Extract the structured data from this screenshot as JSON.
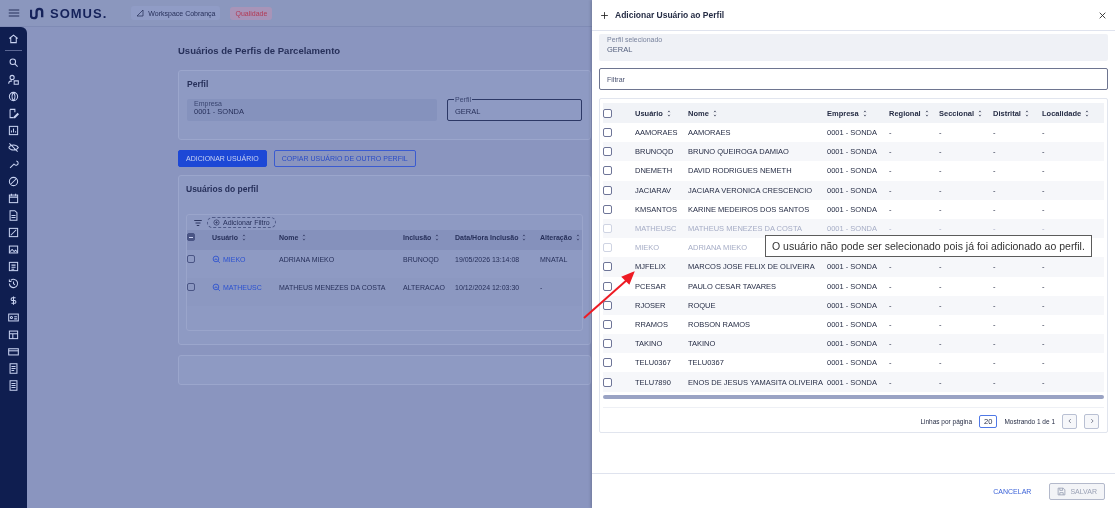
{
  "header": {
    "logo": "SOMUS.",
    "workspace": "Workspace Cobrança",
    "environment": "Qualidade"
  },
  "page": {
    "title": "Usuários de Perfis de Parcelamento",
    "perfil_card": {
      "title": "Perfil",
      "fields": [
        {
          "label": "Empresa",
          "value": "0001 - SONDA",
          "kind": "readonly"
        },
        {
          "label": "Perfil",
          "value": "GERAL",
          "kind": "outlined"
        }
      ]
    },
    "buttons": [
      {
        "label": "ADICIONAR USUÁRIO",
        "kind": "primary"
      },
      {
        "label": "COPIAR USUÁRIO DE OUTRO PERFIL",
        "kind": "outline"
      }
    ],
    "users_card": {
      "title": "Usuários do perfil",
      "filter_chip": "Adicionar Filtro",
      "select_all_indeterminate": true,
      "columns": [
        "Usuário",
        "Nome",
        "Inclusão",
        "Data/Hora Inclusão",
        "Alteração"
      ],
      "rows": [
        {
          "usuario": "MIEKO",
          "nome": "ADRIANA MIEKO",
          "inclusao": "BRUNOQD",
          "data_hora_inclusao": "19/05/2026 13:14:08",
          "alteracao": "MNATAL",
          "checked": false
        },
        {
          "usuario": "MATHEUSC",
          "nome": "MATHEUS MENEZES DA COSTA",
          "inclusao": "ALTERACAO",
          "data_hora_inclusao": "10/12/2024 12:03:30",
          "alteracao": "-",
          "checked": false
        }
      ]
    }
  },
  "drawer": {
    "title": "Adicionar Usuário ao Perfil",
    "selected_profile": {
      "label": "Perfil selecionado",
      "value": "GERAL"
    },
    "filter": {
      "placeholder": "Filtrar"
    },
    "table": {
      "select_all_checked": false,
      "columns": [
        "Usuário",
        "Nome",
        "Empresa",
        "Regional",
        "Seccional",
        "Distrital",
        "Localidade"
      ],
      "rows": [
        {
          "usuario": "AAMORAES",
          "nome": "AAMORAES",
          "empresa": "0001 - SONDA",
          "regional": "-",
          "seccional": "-",
          "distrital": "-",
          "localidade": "-",
          "disabled": false,
          "checked": false
        },
        {
          "usuario": "BRUNOQD",
          "nome": "BRUNO QUEIROGA DAMIAO",
          "empresa": "0001 - SONDA",
          "regional": "-",
          "seccional": "-",
          "distrital": "-",
          "localidade": "-",
          "disabled": false,
          "checked": false
        },
        {
          "usuario": "DNEMETH",
          "nome": "DAVID RODRIGUES NEMETH",
          "empresa": "0001 - SONDA",
          "regional": "-",
          "seccional": "-",
          "distrital": "-",
          "localidade": "-",
          "disabled": false,
          "checked": false
        },
        {
          "usuario": "JACIARAV",
          "nome": "JACIARA VERONICA CRESCENCIO",
          "empresa": "0001 - SONDA",
          "regional": "-",
          "seccional": "-",
          "distrital": "-",
          "localidade": "-",
          "disabled": false,
          "checked": false
        },
        {
          "usuario": "KMSANTOS",
          "nome": "KARINE MEDEIROS DOS SANTOS",
          "empresa": "0001 - SONDA",
          "regional": "-",
          "seccional": "-",
          "distrital": "-",
          "localidade": "-",
          "disabled": false,
          "checked": false
        },
        {
          "usuario": "MATHEUSC",
          "nome": "MATHEUS MENEZES DA COSTA",
          "empresa": "0001 - SONDA",
          "regional": "-",
          "seccional": "-",
          "distrital": "-",
          "localidade": "-",
          "disabled": true,
          "checked": false
        },
        {
          "usuario": "MIEKO",
          "nome": "ADRIANA MIEKO",
          "disabled": true,
          "checked": false,
          "tooltip": "O usuário não pode ser selecionado pois já foi adicionado ao perfil."
        },
        {
          "usuario": "MJFELIX",
          "nome": "MARCOS JOSE FELIX DE OLIVEIRA",
          "empresa": "0001 - SONDA",
          "regional": "-",
          "seccional": "-",
          "distrital": "-",
          "localidade": "-",
          "disabled": false,
          "checked": false
        },
        {
          "usuario": "PCESAR",
          "nome": "PAULO CESAR TAVARES",
          "empresa": "0001 - SONDA",
          "regional": "-",
          "seccional": "-",
          "distrital": "-",
          "localidade": "-",
          "disabled": false,
          "checked": false
        },
        {
          "usuario": "RJOSER",
          "nome": "ROQUE",
          "empresa": "0001 - SONDA",
          "regional": "-",
          "seccional": "-",
          "distrital": "-",
          "localidade": "-",
          "disabled": false,
          "checked": false
        },
        {
          "usuario": "RRAMOS",
          "nome": "ROBSON RAMOS",
          "empresa": "0001 - SONDA",
          "regional": "-",
          "seccional": "-",
          "distrital": "-",
          "localidade": "-",
          "disabled": false,
          "checked": false
        },
        {
          "usuario": "TAKINO",
          "nome": "TAKINO",
          "empresa": "0001 - SONDA",
          "regional": "-",
          "seccional": "-",
          "distrital": "-",
          "localidade": "-",
          "disabled": false,
          "checked": false
        },
        {
          "usuario": "TELU0367",
          "nome": "TELU0367",
          "empresa": "0001 - SONDA",
          "regional": "-",
          "seccional": "-",
          "distrital": "-",
          "localidade": "-",
          "disabled": false,
          "checked": false
        },
        {
          "usuario": "TELU7890",
          "nome": "ENOS DE JESUS YAMASITA OLIVEIRA",
          "empresa": "0001 - SONDA",
          "regional": "-",
          "seccional": "-",
          "distrital": "-",
          "localidade": "-",
          "disabled": false,
          "checked": false
        }
      ]
    },
    "pagination": {
      "rows_per_page_label": "Linhas por página",
      "rows_per_page": "20",
      "showing": "Mostrando 1 de 1"
    },
    "buttons": [
      {
        "label": "CANCELAR",
        "kind": "text",
        "disabled": false
      },
      {
        "label": "SALVAR",
        "kind": "save",
        "disabled": true
      }
    ]
  }
}
